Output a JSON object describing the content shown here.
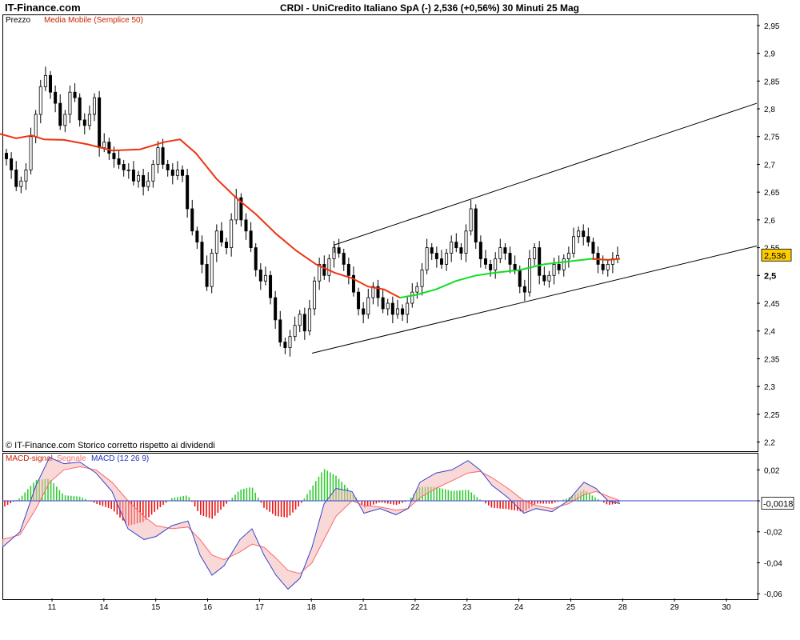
{
  "header": {
    "brand": "IT-Finance.com",
    "title": "CRDI - UniCredito Italiano SpA (-)    2,536 (+0,56%)    30 Minuti  25 Mag"
  },
  "price_panel": {
    "label_price": "Prezzo",
    "label_ma": "Media Mobile (Semplice 50)",
    "copyright": "© IT-Finance.com  Storico corretto rispetto ai dividendi",
    "last_price": "2,536"
  },
  "macd_panel": {
    "label_signal": "MACD-signal",
    "label_segnale": "Segnale",
    "label_macd": "MACD (12 26 9)",
    "last_value": "-0,0018"
  },
  "colors": {
    "ma_down": "#ee3311",
    "ma_up": "#11dd22",
    "hist_pos": "#33cc33",
    "hist_neg": "#ee1111",
    "macd_line": "#3344cc",
    "signal_line": "#ff6666",
    "label_red": "#cc2200",
    "label_blue": "#2233bb"
  },
  "chart_data": [
    {
      "type": "candlestick",
      "title": "CRDI - UniCredito Italiano SpA (-)",
      "xlabel": "",
      "ylabel": "",
      "x_ticks": [
        "11",
        "14",
        "15",
        "16",
        "17",
        "18",
        "21",
        "22",
        "23",
        "24",
        "25",
        "28",
        "29",
        "30"
      ],
      "y_ticks": [
        "2,95",
        "2,9",
        "2,85",
        "2,8",
        "2,75",
        "2,7",
        "2,65",
        "2,6",
        "2,55",
        "2,5",
        "2,45",
        "2,4",
        "2,35",
        "2,3",
        "2,25",
        "2,2"
      ],
      "ylim": [
        2.185,
        2.97
      ],
      "close_path": [
        2.71,
        2.69,
        2.66,
        2.67,
        2.69,
        2.75,
        2.79,
        2.84,
        2.86,
        2.83,
        2.81,
        2.77,
        2.79,
        2.83,
        2.82,
        2.78,
        2.77,
        2.79,
        2.82,
        2.73,
        2.74,
        2.72,
        2.71,
        2.7,
        2.69,
        2.69,
        2.67,
        2.68,
        2.66,
        2.67,
        2.7,
        2.73,
        2.7,
        2.69,
        2.68,
        2.69,
        2.68,
        2.62,
        2.58,
        2.56,
        2.52,
        2.48,
        2.54,
        2.58,
        2.56,
        2.55,
        2.6,
        2.64,
        2.6,
        2.58,
        2.55,
        2.51,
        2.49,
        2.5,
        2.46,
        2.42,
        2.38,
        2.37,
        2.39,
        2.41,
        2.43,
        2.4,
        2.44,
        2.49,
        2.52,
        2.5,
        2.53,
        2.55,
        2.54,
        2.52,
        2.5,
        2.47,
        2.44,
        2.43,
        2.46,
        2.48,
        2.46,
        2.44,
        2.45,
        2.43,
        2.44,
        2.43,
        2.45,
        2.47,
        2.48,
        2.51,
        2.55,
        2.54,
        2.53,
        2.52,
        2.54,
        2.56,
        2.55,
        2.54,
        2.58,
        2.62,
        2.56,
        2.53,
        2.52,
        2.51,
        2.53,
        2.55,
        2.54,
        2.52,
        2.51,
        2.48,
        2.47,
        2.53,
        2.55,
        2.5,
        2.49,
        2.5,
        2.52,
        2.51,
        2.53,
        2.54,
        2.57,
        2.58,
        2.57,
        2.56,
        2.54,
        2.52,
        2.51,
        2.52,
        2.53,
        2.536
      ],
      "moving_average_50": [
        [
          0,
          2.755
        ],
        [
          20,
          2.747
        ],
        [
          40,
          2.752
        ],
        [
          55,
          2.745
        ],
        [
          80,
          2.744
        ],
        [
          110,
          2.736
        ],
        [
          140,
          2.725
        ],
        [
          175,
          2.727
        ],
        [
          205,
          2.74
        ],
        [
          225,
          2.745
        ],
        [
          245,
          2.72
        ],
        [
          270,
          2.675
        ],
        [
          295,
          2.64
        ],
        [
          320,
          2.61
        ],
        [
          345,
          2.575
        ],
        [
          370,
          2.545
        ],
        [
          395,
          2.52
        ],
        [
          418,
          2.505
        ],
        [
          440,
          2.495
        ],
        [
          460,
          2.48
        ],
        [
          480,
          2.475
        ],
        [
          500,
          2.46
        ],
        [
          520,
          2.465
        ],
        [
          545,
          2.475
        ],
        [
          570,
          2.49
        ],
        [
          595,
          2.5
        ],
        [
          620,
          2.505
        ],
        [
          650,
          2.51
        ],
        [
          680,
          2.52
        ],
        [
          710,
          2.525
        ],
        [
          740,
          2.53
        ],
        [
          760,
          2.528
        ],
        [
          775,
          2.53
        ]
      ],
      "ma_rising_from_x": 500,
      "channel_upper": [
        [
          418,
          2.555
        ],
        [
          946,
          2.81
        ]
      ],
      "channel_lower": [
        [
          390,
          2.36
        ],
        [
          946,
          2.553
        ]
      ],
      "last": 2.536,
      "change_pct": "+0,56%"
    },
    {
      "type": "macd",
      "name": "MACD (12 26 9)",
      "y_ticks": [
        "0,02",
        "0",
        "-0,02",
        "-0,04",
        "-0,06"
      ],
      "ylim": [
        -0.063,
        0.031
      ],
      "macd": [
        [
          3,
          -0.03
        ],
        [
          25,
          -0.02
        ],
        [
          45,
          0.01
        ],
        [
          62,
          0.028
        ],
        [
          80,
          0.024
        ],
        [
          100,
          0.025
        ],
        [
          120,
          0.018
        ],
        [
          140,
          0.006
        ],
        [
          160,
          -0.018
        ],
        [
          180,
          -0.025
        ],
        [
          195,
          -0.023
        ],
        [
          215,
          -0.016
        ],
        [
          235,
          -0.013
        ],
        [
          250,
          -0.035
        ],
        [
          265,
          -0.048
        ],
        [
          280,
          -0.042
        ],
        [
          300,
          -0.025
        ],
        [
          315,
          -0.018
        ],
        [
          330,
          -0.035
        ],
        [
          345,
          -0.048
        ],
        [
          360,
          -0.057
        ],
        [
          375,
          -0.05
        ],
        [
          390,
          -0.03
        ],
        [
          405,
          -0.002
        ],
        [
          420,
          0.008
        ],
        [
          440,
          0.006
        ],
        [
          455,
          -0.008
        ],
        [
          475,
          -0.005
        ],
        [
          495,
          -0.009
        ],
        [
          510,
          -0.005
        ],
        [
          525,
          0.012
        ],
        [
          545,
          0.018
        ],
        [
          565,
          0.02
        ],
        [
          585,
          0.026
        ],
        [
          600,
          0.02
        ],
        [
          615,
          0.01
        ],
        [
          635,
          0.002
        ],
        [
          655,
          -0.008
        ],
        [
          670,
          -0.005
        ],
        [
          690,
          -0.007
        ],
        [
          710,
          0.0
        ],
        [
          730,
          0.012
        ],
        [
          745,
          0.008
        ],
        [
          760,
          0.0
        ],
        [
          775,
          -0.0018
        ]
      ],
      "signal": [
        [
          3,
          -0.025
        ],
        [
          25,
          -0.022
        ],
        [
          45,
          -0.005
        ],
        [
          62,
          0.012
        ],
        [
          80,
          0.02
        ],
        [
          100,
          0.022
        ],
        [
          120,
          0.02
        ],
        [
          140,
          0.012
        ],
        [
          160,
          0.0
        ],
        [
          180,
          -0.01
        ],
        [
          195,
          -0.016
        ],
        [
          215,
          -0.018
        ],
        [
          235,
          -0.017
        ],
        [
          250,
          -0.025
        ],
        [
          265,
          -0.035
        ],
        [
          280,
          -0.038
        ],
        [
          300,
          -0.033
        ],
        [
          315,
          -0.028
        ],
        [
          330,
          -0.03
        ],
        [
          345,
          -0.037
        ],
        [
          360,
          -0.045
        ],
        [
          375,
          -0.047
        ],
        [
          390,
          -0.04
        ],
        [
          405,
          -0.025
        ],
        [
          420,
          -0.01
        ],
        [
          440,
          0.0
        ],
        [
          455,
          -0.003
        ],
        [
          475,
          -0.004
        ],
        [
          495,
          -0.006
        ],
        [
          510,
          -0.005
        ],
        [
          525,
          0.002
        ],
        [
          545,
          0.008
        ],
        [
          565,
          0.013
        ],
        [
          585,
          0.018
        ],
        [
          600,
          0.019
        ],
        [
          615,
          0.015
        ],
        [
          635,
          0.008
        ],
        [
          655,
          0.0
        ],
        [
          670,
          -0.003
        ],
        [
          690,
          -0.005
        ],
        [
          710,
          -0.002
        ],
        [
          730,
          0.004
        ],
        [
          745,
          0.006
        ],
        [
          760,
          0.003
        ],
        [
          775,
          0.0
        ]
      ],
      "last": -0.0018
    }
  ]
}
